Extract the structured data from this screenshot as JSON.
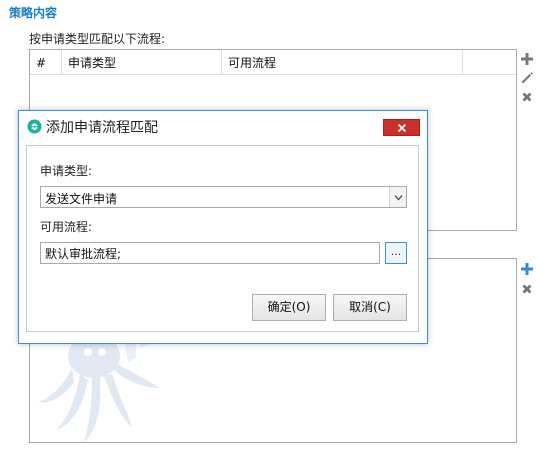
{
  "section": {
    "title": "策略内容"
  },
  "main": {
    "intro_label": "按申请类型匹配以下流程:"
  },
  "table": {
    "columns": [
      "#",
      "申请类型",
      "可用流程"
    ]
  },
  "dialog": {
    "title": "添加申请流程匹配",
    "type_label": "申请类型:",
    "type_value": "发送文件申请",
    "flow_label": "可用流程:",
    "flow_value": "默认审批流程;",
    "browse_label": "...",
    "ok_label": "确定(O)",
    "cancel_label": "取消(C)"
  },
  "colors": {
    "accent": "#1a7fc9",
    "close_button": "#c9302c",
    "dialog_border": "#3c8ddb"
  },
  "icons": {
    "upper_tools": [
      "plus-icon",
      "pencil-icon",
      "x-icon"
    ],
    "lower_tools": [
      "plus-icon",
      "x-icon"
    ]
  }
}
